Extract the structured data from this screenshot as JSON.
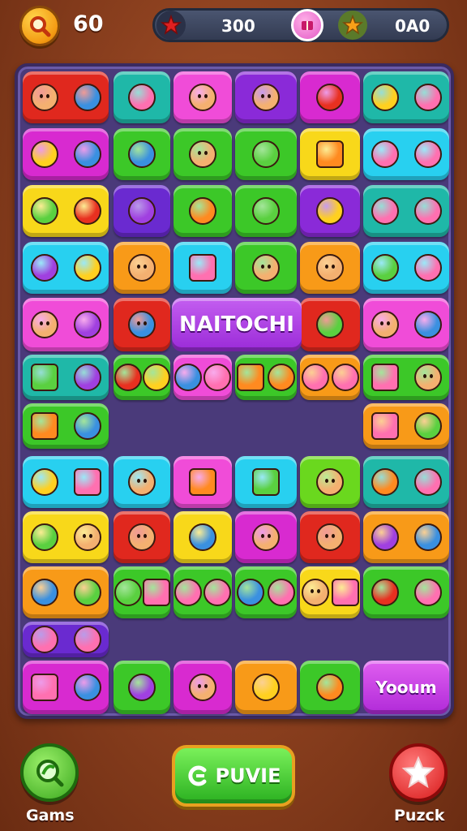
{
  "hud": {
    "coins": "60",
    "resource_left": "300",
    "resource_right": "0A0"
  },
  "board": {
    "banner_center": "NAITOCHI",
    "banner_bottom_right": "Yooum"
  },
  "bottom_bar": {
    "games_label": "Gams",
    "play_label": "PUVIE",
    "puzzle_label": "Puzck"
  },
  "colors": {
    "red": "#e0281e",
    "teal": "#1fb8a8",
    "pink": "#f04cd8",
    "purple": "#8a2ad8",
    "magenta": "#d82ad0",
    "green": "#3cc828",
    "yellow": "#f8d81a",
    "orange": "#f89a18",
    "cyan": "#28d0f0",
    "lime": "#6ad81e",
    "violet": "#6a2ad0"
  },
  "tiles": [
    {
      "row": 0,
      "col": 0,
      "color": "red",
      "icons": [
        "brown-face-icon",
        "blue-fish-icon"
      ]
    },
    {
      "row": 0,
      "col": 1,
      "color": "teal",
      "icons": [
        "magnifier-icon"
      ]
    },
    {
      "row": 0,
      "col": 2,
      "color": "pink",
      "icons": [
        "cat-face-icon"
      ]
    },
    {
      "row": 0,
      "col": 3,
      "color": "purple",
      "icons": [
        "fox-face-icon"
      ]
    },
    {
      "row": 0,
      "col": 4,
      "color": "magenta",
      "icons": [
        "red-apple-icon"
      ]
    },
    {
      "row": 0,
      "col": 5,
      "color": "teal",
      "icons": [
        "sun-icon",
        "umbrella-icon"
      ]
    },
    {
      "row": 1,
      "col": 0,
      "color": "magenta",
      "icons": [
        "banana-icon",
        "orange-drop-icon"
      ]
    },
    {
      "row": 1,
      "col": 1,
      "color": "green",
      "icons": [
        "blue-bottle-icon"
      ]
    },
    {
      "row": 1,
      "col": 2,
      "color": "green",
      "icons": [
        "girl-face-icon"
      ]
    },
    {
      "row": 1,
      "col": 3,
      "color": "green",
      "icons": [
        "pyramid-icon"
      ]
    },
    {
      "row": 1,
      "col": 4,
      "color": "yellow",
      "icons": [
        "basket-icon"
      ]
    },
    {
      "row": 1,
      "col": 5,
      "color": "cyan",
      "icons": [
        "mushroom-icon",
        "spiral-icon"
      ]
    },
    {
      "row": 2,
      "col": 0,
      "color": "yellow",
      "icons": [
        "lime-icon",
        "berry-icon"
      ]
    },
    {
      "row": 2,
      "col": 1,
      "color": "violet",
      "icons": [
        "pencil-icon"
      ]
    },
    {
      "row": 2,
      "col": 2,
      "color": "green",
      "icons": [
        "carrot-icon"
      ]
    },
    {
      "row": 2,
      "col": 3,
      "color": "green",
      "icons": [
        "green-blob-icon"
      ]
    },
    {
      "row": 2,
      "col": 4,
      "color": "purple",
      "icons": [
        "bell-icon"
      ]
    },
    {
      "row": 2,
      "col": 5,
      "color": "teal",
      "icons": [
        "snowman-icon",
        "pink-blob-icon"
      ]
    },
    {
      "row": 3,
      "col": 0,
      "color": "cyan",
      "icons": [
        "purple-cat-icon",
        "sunflower-icon"
      ]
    },
    {
      "row": 3,
      "col": 1,
      "color": "orange",
      "icons": [
        "smile-icon"
      ]
    },
    {
      "row": 3,
      "col": 2,
      "color": "cyan",
      "icons": [
        "bag-icon"
      ]
    },
    {
      "row": 3,
      "col": 3,
      "color": "green",
      "icons": [
        "smile-icon"
      ]
    },
    {
      "row": 3,
      "col": 4,
      "color": "orange",
      "icons": [
        "smile-icon"
      ]
    },
    {
      "row": 3,
      "col": 5,
      "color": "cyan",
      "icons": [
        "leaf-icon",
        "flower-icon"
      ]
    },
    {
      "row": 4,
      "col": 0,
      "color": "pink",
      "icons": [
        "boy-face-icon",
        "plum-icon"
      ]
    },
    {
      "row": 4,
      "col": 1,
      "color": "red",
      "icons": [
        "blue-monster-icon"
      ]
    },
    {
      "row": 4,
      "col": 4,
      "color": "red",
      "icons": [
        "green-splat-icon"
      ]
    },
    {
      "row": 4,
      "col": 5,
      "color": "pink",
      "icons": [
        "crowned-face-icon",
        "orange-drop-icon"
      ]
    },
    {
      "row": 5,
      "col": 0,
      "color": "teal",
      "icons": [
        "green-cube-icon",
        "gear-icon"
      ]
    },
    {
      "row": 5,
      "col": 1,
      "color": "green",
      "icons": [
        "shield-icon",
        "star-icon"
      ]
    },
    {
      "row": 5,
      "col": 2,
      "color": "pink",
      "icons": [
        "blue-star-icon",
        "spiral-icon"
      ]
    },
    {
      "row": 5,
      "col": 3,
      "color": "green",
      "icons": [
        "basket-icon",
        "bread-icon"
      ]
    },
    {
      "row": 5,
      "col": 4,
      "color": "orange",
      "icons": [
        "mirror-icon",
        "car-icon"
      ]
    },
    {
      "row": 5,
      "col": 5,
      "color": "green",
      "icons": [
        "block-icon",
        "orange-face-icon"
      ]
    },
    {
      "row": 6,
      "col": 0,
      "color": "green",
      "icons": [
        "orange-cube-icon",
        "blue-drop-icon"
      ]
    },
    {
      "row": 6,
      "col": 5,
      "color": "orange",
      "icons": [
        "phone-icon",
        "plant-icon"
      ]
    },
    {
      "row": 7,
      "col": 0,
      "color": "cyan",
      "icons": [
        "banana-icon",
        "gift-icon"
      ]
    },
    {
      "row": 7,
      "col": 1,
      "color": "cyan",
      "icons": [
        "boy-face-icon"
      ]
    },
    {
      "row": 7,
      "col": 2,
      "color": "pink",
      "icons": [
        "basket-icon"
      ]
    },
    {
      "row": 7,
      "col": 3,
      "color": "cyan",
      "icons": [
        "green-bag-icon"
      ]
    },
    {
      "row": 7,
      "col": 4,
      "color": "lime",
      "icons": [
        "fox-boy-icon"
      ]
    },
    {
      "row": 7,
      "col": 5,
      "color": "teal",
      "icons": [
        "sausage-icon",
        "swirl-icon"
      ]
    },
    {
      "row": 8,
      "col": 0,
      "color": "yellow",
      "icons": [
        "leaf-icon",
        "fox-face-icon"
      ]
    },
    {
      "row": 8,
      "col": 1,
      "color": "red",
      "icons": [
        "red-face-icon"
      ]
    },
    {
      "row": 8,
      "col": 2,
      "color": "yellow",
      "icons": [
        "teal-drop-icon"
      ]
    },
    {
      "row": 8,
      "col": 3,
      "color": "magenta",
      "icons": [
        "smiley-icon"
      ]
    },
    {
      "row": 8,
      "col": 4,
      "color": "red",
      "icons": [
        "hat-face-icon"
      ]
    },
    {
      "row": 8,
      "col": 5,
      "color": "orange",
      "icons": [
        "crystal-icon",
        "green-drop-icon"
      ]
    },
    {
      "row": 9,
      "col": 0,
      "color": "orange",
      "icons": [
        "orange-drop-icon",
        "green-splat-icon"
      ]
    },
    {
      "row": 9,
      "col": 1,
      "color": "green",
      "icons": [
        "pyramid-icon",
        "chest-icon"
      ]
    },
    {
      "row": 9,
      "col": 2,
      "color": "green",
      "icons": [
        "planet-icon",
        "flower-icon"
      ]
    },
    {
      "row": 9,
      "col": 3,
      "color": "green",
      "icons": [
        "eye-icon",
        "stone-icon"
      ]
    },
    {
      "row": 9,
      "col": 4,
      "color": "yellow",
      "icons": [
        "smile-icon",
        "radio-icon"
      ]
    },
    {
      "row": 9,
      "col": 5,
      "color": "green",
      "icons": [
        "tomato-icon",
        "flower-icon"
      ]
    },
    {
      "row": 10,
      "col": 0,
      "color": "violet",
      "icons": [
        "glasses-icon",
        "ice-cream-icon"
      ]
    },
    {
      "row": 11,
      "col": 0,
      "color": "magenta",
      "icons": [
        "book-icon",
        "orange-drop-icon"
      ]
    },
    {
      "row": 11,
      "col": 1,
      "color": "green",
      "icons": [
        "crystal-ball-icon"
      ]
    },
    {
      "row": 11,
      "col": 2,
      "color": "magenta",
      "icons": [
        "cat-face-icon"
      ]
    },
    {
      "row": 11,
      "col": 3,
      "color": "orange",
      "icons": [
        "pink-star-icon"
      ]
    },
    {
      "row": 11,
      "col": 4,
      "color": "green",
      "icons": [
        "pot-icon"
      ]
    }
  ]
}
